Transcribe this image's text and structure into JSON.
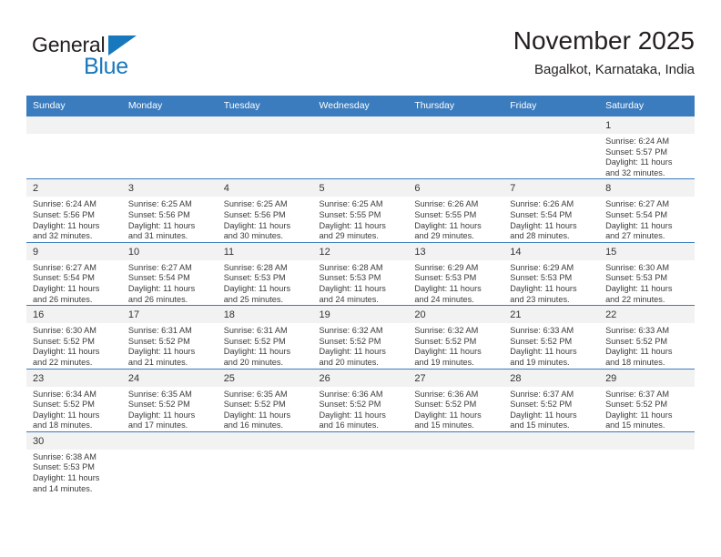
{
  "brand": {
    "name_dark": "General",
    "name_blue": "Blue",
    "accent_color": "#1878be"
  },
  "header": {
    "title": "November 2025",
    "subtitle": "Bagalkot, Karnataka, India"
  },
  "theme": {
    "header_bg": "#3a7cbe",
    "header_text": "#ffffff",
    "daynum_bg": "#f2f2f2",
    "grid_line": "#3a7cbe"
  },
  "weekdays": [
    "Sunday",
    "Monday",
    "Tuesday",
    "Wednesday",
    "Thursday",
    "Friday",
    "Saturday"
  ],
  "weeks": [
    [
      {
        "day": "",
        "blank": true
      },
      {
        "day": "",
        "blank": true
      },
      {
        "day": "",
        "blank": true
      },
      {
        "day": "",
        "blank": true
      },
      {
        "day": "",
        "blank": true
      },
      {
        "day": "",
        "blank": true
      },
      {
        "day": "1",
        "sunrise": "Sunrise: 6:24 AM",
        "sunset": "Sunset: 5:57 PM",
        "daylight1": "Daylight: 11 hours",
        "daylight2": "and 32 minutes."
      }
    ],
    [
      {
        "day": "2",
        "sunrise": "Sunrise: 6:24 AM",
        "sunset": "Sunset: 5:56 PM",
        "daylight1": "Daylight: 11 hours",
        "daylight2": "and 32 minutes."
      },
      {
        "day": "3",
        "sunrise": "Sunrise: 6:25 AM",
        "sunset": "Sunset: 5:56 PM",
        "daylight1": "Daylight: 11 hours",
        "daylight2": "and 31 minutes."
      },
      {
        "day": "4",
        "sunrise": "Sunrise: 6:25 AM",
        "sunset": "Sunset: 5:56 PM",
        "daylight1": "Daylight: 11 hours",
        "daylight2": "and 30 minutes."
      },
      {
        "day": "5",
        "sunrise": "Sunrise: 6:25 AM",
        "sunset": "Sunset: 5:55 PM",
        "daylight1": "Daylight: 11 hours",
        "daylight2": "and 29 minutes."
      },
      {
        "day": "6",
        "sunrise": "Sunrise: 6:26 AM",
        "sunset": "Sunset: 5:55 PM",
        "daylight1": "Daylight: 11 hours",
        "daylight2": "and 29 minutes."
      },
      {
        "day": "7",
        "sunrise": "Sunrise: 6:26 AM",
        "sunset": "Sunset: 5:54 PM",
        "daylight1": "Daylight: 11 hours",
        "daylight2": "and 28 minutes."
      },
      {
        "day": "8",
        "sunrise": "Sunrise: 6:27 AM",
        "sunset": "Sunset: 5:54 PM",
        "daylight1": "Daylight: 11 hours",
        "daylight2": "and 27 minutes."
      }
    ],
    [
      {
        "day": "9",
        "sunrise": "Sunrise: 6:27 AM",
        "sunset": "Sunset: 5:54 PM",
        "daylight1": "Daylight: 11 hours",
        "daylight2": "and 26 minutes."
      },
      {
        "day": "10",
        "sunrise": "Sunrise: 6:27 AM",
        "sunset": "Sunset: 5:54 PM",
        "daylight1": "Daylight: 11 hours",
        "daylight2": "and 26 minutes."
      },
      {
        "day": "11",
        "sunrise": "Sunrise: 6:28 AM",
        "sunset": "Sunset: 5:53 PM",
        "daylight1": "Daylight: 11 hours",
        "daylight2": "and 25 minutes."
      },
      {
        "day": "12",
        "sunrise": "Sunrise: 6:28 AM",
        "sunset": "Sunset: 5:53 PM",
        "daylight1": "Daylight: 11 hours",
        "daylight2": "and 24 minutes."
      },
      {
        "day": "13",
        "sunrise": "Sunrise: 6:29 AM",
        "sunset": "Sunset: 5:53 PM",
        "daylight1": "Daylight: 11 hours",
        "daylight2": "and 24 minutes."
      },
      {
        "day": "14",
        "sunrise": "Sunrise: 6:29 AM",
        "sunset": "Sunset: 5:53 PM",
        "daylight1": "Daylight: 11 hours",
        "daylight2": "and 23 minutes."
      },
      {
        "day": "15",
        "sunrise": "Sunrise: 6:30 AM",
        "sunset": "Sunset: 5:53 PM",
        "daylight1": "Daylight: 11 hours",
        "daylight2": "and 22 minutes."
      }
    ],
    [
      {
        "day": "16",
        "sunrise": "Sunrise: 6:30 AM",
        "sunset": "Sunset: 5:52 PM",
        "daylight1": "Daylight: 11 hours",
        "daylight2": "and 22 minutes."
      },
      {
        "day": "17",
        "sunrise": "Sunrise: 6:31 AM",
        "sunset": "Sunset: 5:52 PM",
        "daylight1": "Daylight: 11 hours",
        "daylight2": "and 21 minutes."
      },
      {
        "day": "18",
        "sunrise": "Sunrise: 6:31 AM",
        "sunset": "Sunset: 5:52 PM",
        "daylight1": "Daylight: 11 hours",
        "daylight2": "and 20 minutes."
      },
      {
        "day": "19",
        "sunrise": "Sunrise: 6:32 AM",
        "sunset": "Sunset: 5:52 PM",
        "daylight1": "Daylight: 11 hours",
        "daylight2": "and 20 minutes."
      },
      {
        "day": "20",
        "sunrise": "Sunrise: 6:32 AM",
        "sunset": "Sunset: 5:52 PM",
        "daylight1": "Daylight: 11 hours",
        "daylight2": "and 19 minutes."
      },
      {
        "day": "21",
        "sunrise": "Sunrise: 6:33 AM",
        "sunset": "Sunset: 5:52 PM",
        "daylight1": "Daylight: 11 hours",
        "daylight2": "and 19 minutes."
      },
      {
        "day": "22",
        "sunrise": "Sunrise: 6:33 AM",
        "sunset": "Sunset: 5:52 PM",
        "daylight1": "Daylight: 11 hours",
        "daylight2": "and 18 minutes."
      }
    ],
    [
      {
        "day": "23",
        "sunrise": "Sunrise: 6:34 AM",
        "sunset": "Sunset: 5:52 PM",
        "daylight1": "Daylight: 11 hours",
        "daylight2": "and 18 minutes."
      },
      {
        "day": "24",
        "sunrise": "Sunrise: 6:35 AM",
        "sunset": "Sunset: 5:52 PM",
        "daylight1": "Daylight: 11 hours",
        "daylight2": "and 17 minutes."
      },
      {
        "day": "25",
        "sunrise": "Sunrise: 6:35 AM",
        "sunset": "Sunset: 5:52 PM",
        "daylight1": "Daylight: 11 hours",
        "daylight2": "and 16 minutes."
      },
      {
        "day": "26",
        "sunrise": "Sunrise: 6:36 AM",
        "sunset": "Sunset: 5:52 PM",
        "daylight1": "Daylight: 11 hours",
        "daylight2": "and 16 minutes."
      },
      {
        "day": "27",
        "sunrise": "Sunrise: 6:36 AM",
        "sunset": "Sunset: 5:52 PM",
        "daylight1": "Daylight: 11 hours",
        "daylight2": "and 15 minutes."
      },
      {
        "day": "28",
        "sunrise": "Sunrise: 6:37 AM",
        "sunset": "Sunset: 5:52 PM",
        "daylight1": "Daylight: 11 hours",
        "daylight2": "and 15 minutes."
      },
      {
        "day": "29",
        "sunrise": "Sunrise: 6:37 AM",
        "sunset": "Sunset: 5:52 PM",
        "daylight1": "Daylight: 11 hours",
        "daylight2": "and 15 minutes."
      }
    ],
    [
      {
        "day": "30",
        "sunrise": "Sunrise: 6:38 AM",
        "sunset": "Sunset: 5:53 PM",
        "daylight1": "Daylight: 11 hours",
        "daylight2": "and 14 minutes."
      },
      {
        "day": "",
        "blank": true
      },
      {
        "day": "",
        "blank": true
      },
      {
        "day": "",
        "blank": true
      },
      {
        "day": "",
        "blank": true
      },
      {
        "day": "",
        "blank": true
      },
      {
        "day": "",
        "blank": true
      }
    ]
  ]
}
